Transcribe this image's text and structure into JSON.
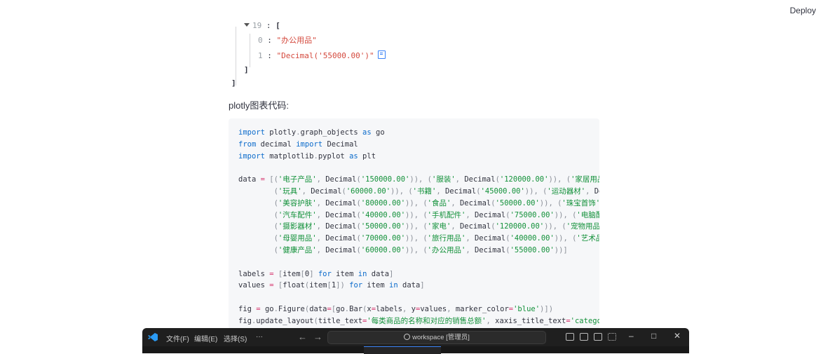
{
  "header": {
    "deploy_label": "Deploy"
  },
  "json_view": {
    "open_key": "19",
    "open_bracket": "[",
    "items": [
      {
        "key": "0",
        "value": "\"办公用品\""
      },
      {
        "key": "1",
        "value": "\"Decimal('55000.00')\""
      }
    ],
    "close_inner": "]",
    "close_outer": "]"
  },
  "section_label": "plotly图表代码:",
  "code_lines": [
    [
      [
        "kw",
        "import"
      ],
      [
        "t",
        " plotly"
      ],
      [
        "pn",
        "."
      ],
      [
        "t",
        "graph_objects "
      ],
      [
        "kw",
        "as"
      ],
      [
        "t",
        " go"
      ]
    ],
    [
      [
        "kw",
        "from"
      ],
      [
        "t",
        " decimal "
      ],
      [
        "kw",
        "import"
      ],
      [
        "t",
        " Decimal"
      ]
    ],
    [
      [
        "kw",
        "import"
      ],
      [
        "t",
        " matplotlib"
      ],
      [
        "pn",
        "."
      ],
      [
        "t",
        "pyplot "
      ],
      [
        "kw",
        "as"
      ],
      [
        "t",
        " plt"
      ]
    ],
    [
      [
        "t",
        ""
      ]
    ],
    [
      [
        "t",
        "data "
      ],
      [
        "op",
        "="
      ],
      [
        "t",
        " "
      ],
      [
        "pn",
        "[("
      ],
      [
        "st",
        "'电子产品'"
      ],
      [
        "pn",
        ", "
      ],
      [
        "t",
        "Decimal"
      ],
      [
        "pn",
        "("
      ],
      [
        "st",
        "'150000.00'"
      ],
      [
        "pn",
        "))"
      ],
      [
        "pn",
        ", ("
      ],
      [
        "st",
        "'服装'"
      ],
      [
        "pn",
        ", "
      ],
      [
        "t",
        "Decimal"
      ],
      [
        "pn",
        "("
      ],
      [
        "st",
        "'120000.00'"
      ],
      [
        "pn",
        "))"
      ],
      [
        "pn",
        ", ("
      ],
      [
        "st",
        "'家居用品'"
      ]
    ],
    [
      [
        "t",
        "        "
      ],
      [
        "pn",
        "("
      ],
      [
        "st",
        "'玩具'"
      ],
      [
        "pn",
        ", "
      ],
      [
        "t",
        "Decimal"
      ],
      [
        "pn",
        "("
      ],
      [
        "st",
        "'60000.00'"
      ],
      [
        "pn",
        "))"
      ],
      [
        "pn",
        ", ("
      ],
      [
        "st",
        "'书籍'"
      ],
      [
        "pn",
        ", "
      ],
      [
        "t",
        "Decimal"
      ],
      [
        "pn",
        "("
      ],
      [
        "st",
        "'45000.00'"
      ],
      [
        "pn",
        "))"
      ],
      [
        "pn",
        ", ("
      ],
      [
        "st",
        "'运动器材'"
      ],
      [
        "pn",
        ", "
      ],
      [
        "t",
        "De"
      ]
    ],
    [
      [
        "t",
        "        "
      ],
      [
        "pn",
        "("
      ],
      [
        "st",
        "'美容护肤'"
      ],
      [
        "pn",
        ", "
      ],
      [
        "t",
        "Decimal"
      ],
      [
        "pn",
        "("
      ],
      [
        "st",
        "'80000.00'"
      ],
      [
        "pn",
        "))"
      ],
      [
        "pn",
        ", ("
      ],
      [
        "st",
        "'食品'"
      ],
      [
        "pn",
        ", "
      ],
      [
        "t",
        "Decimal"
      ],
      [
        "pn",
        "("
      ],
      [
        "st",
        "'50000.00'"
      ],
      [
        "pn",
        "))"
      ],
      [
        "pn",
        ", ("
      ],
      [
        "st",
        "'珠宝首饰'"
      ]
    ],
    [
      [
        "t",
        "        "
      ],
      [
        "pn",
        "("
      ],
      [
        "st",
        "'汽车配件'"
      ],
      [
        "pn",
        ", "
      ],
      [
        "t",
        "Decimal"
      ],
      [
        "pn",
        "("
      ],
      [
        "st",
        "'40000.00'"
      ],
      [
        "pn",
        "))"
      ],
      [
        "pn",
        ", ("
      ],
      [
        "st",
        "'手机配件'"
      ],
      [
        "pn",
        ", "
      ],
      [
        "t",
        "Decimal"
      ],
      [
        "pn",
        "("
      ],
      [
        "st",
        "'75000.00'"
      ],
      [
        "pn",
        "))"
      ],
      [
        "pn",
        ", ("
      ],
      [
        "st",
        "'电脑配"
      ]
    ],
    [
      [
        "t",
        "        "
      ],
      [
        "pn",
        "("
      ],
      [
        "st",
        "'摄影器材'"
      ],
      [
        "pn",
        ", "
      ],
      [
        "t",
        "Decimal"
      ],
      [
        "pn",
        "("
      ],
      [
        "st",
        "'50000.00'"
      ],
      [
        "pn",
        "))"
      ],
      [
        "pn",
        ", ("
      ],
      [
        "st",
        "'家电'"
      ],
      [
        "pn",
        ", "
      ],
      [
        "t",
        "Decimal"
      ],
      [
        "pn",
        "("
      ],
      [
        "st",
        "'120000.00'"
      ],
      [
        "pn",
        "))"
      ],
      [
        "pn",
        ", ("
      ],
      [
        "st",
        "'宠物用品"
      ]
    ],
    [
      [
        "t",
        "        "
      ],
      [
        "pn",
        "("
      ],
      [
        "st",
        "'母婴用品'"
      ],
      [
        "pn",
        ", "
      ],
      [
        "t",
        "Decimal"
      ],
      [
        "pn",
        "("
      ],
      [
        "st",
        "'70000.00'"
      ],
      [
        "pn",
        "))"
      ],
      [
        "pn",
        ", ("
      ],
      [
        "st",
        "'旅行用品'"
      ],
      [
        "pn",
        ", "
      ],
      [
        "t",
        "Decimal"
      ],
      [
        "pn",
        "("
      ],
      [
        "st",
        "'40000.00'"
      ],
      [
        "pn",
        "))"
      ],
      [
        "pn",
        ", ("
      ],
      [
        "st",
        "'艺术品"
      ]
    ],
    [
      [
        "t",
        "        "
      ],
      [
        "pn",
        "("
      ],
      [
        "st",
        "'健康产品'"
      ],
      [
        "pn",
        ", "
      ],
      [
        "t",
        "Decimal"
      ],
      [
        "pn",
        "("
      ],
      [
        "st",
        "'60000.00'"
      ],
      [
        "pn",
        "))"
      ],
      [
        "pn",
        ", ("
      ],
      [
        "st",
        "'办公用品'"
      ],
      [
        "pn",
        ", "
      ],
      [
        "t",
        "Decimal"
      ],
      [
        "pn",
        "("
      ],
      [
        "st",
        "'55000.00'"
      ],
      [
        "pn",
        "))]"
      ]
    ],
    [
      [
        "t",
        ""
      ]
    ],
    [
      [
        "t",
        "labels "
      ],
      [
        "op",
        "="
      ],
      [
        "t",
        " "
      ],
      [
        "pn",
        "["
      ],
      [
        "t",
        "item"
      ],
      [
        "pn",
        "["
      ],
      [
        "t",
        "0"
      ],
      [
        "pn",
        "]"
      ],
      [
        "t",
        " "
      ],
      [
        "kw",
        "for"
      ],
      [
        "t",
        " item "
      ],
      [
        "kw",
        "in"
      ],
      [
        "t",
        " data"
      ],
      [
        "pn",
        "]"
      ]
    ],
    [
      [
        "t",
        "values "
      ],
      [
        "op",
        "="
      ],
      [
        "t",
        " "
      ],
      [
        "pn",
        "["
      ],
      [
        "t",
        "float"
      ],
      [
        "pn",
        "("
      ],
      [
        "t",
        "item"
      ],
      [
        "pn",
        "["
      ],
      [
        "t",
        "1"
      ],
      [
        "pn",
        "])"
      ],
      [
        "t",
        " "
      ],
      [
        "kw",
        "for"
      ],
      [
        "t",
        " item "
      ],
      [
        "kw",
        "in"
      ],
      [
        "t",
        " data"
      ],
      [
        "pn",
        "]"
      ]
    ],
    [
      [
        "t",
        ""
      ]
    ],
    [
      [
        "t",
        "fig "
      ],
      [
        "op",
        "="
      ],
      [
        "t",
        " go"
      ],
      [
        "pn",
        "."
      ],
      [
        "t",
        "Figure"
      ],
      [
        "pn",
        "("
      ],
      [
        "t",
        "data"
      ],
      [
        "op",
        "="
      ],
      [
        "pn",
        "["
      ],
      [
        "t",
        "go"
      ],
      [
        "pn",
        "."
      ],
      [
        "t",
        "Bar"
      ],
      [
        "pn",
        "("
      ],
      [
        "t",
        "x"
      ],
      [
        "op",
        "="
      ],
      [
        "t",
        "labels"
      ],
      [
        "pn",
        ", "
      ],
      [
        "t",
        "y"
      ],
      [
        "op",
        "="
      ],
      [
        "t",
        "values"
      ],
      [
        "pn",
        ", "
      ],
      [
        "t",
        "marker_color"
      ],
      [
        "op",
        "="
      ],
      [
        "st",
        "'blue'"
      ],
      [
        "pn",
        ")])"
      ]
    ],
    [
      [
        "t",
        "fig"
      ],
      [
        "pn",
        "."
      ],
      [
        "t",
        "update_layout"
      ],
      [
        "pn",
        "("
      ],
      [
        "t",
        "title_text"
      ],
      [
        "op",
        "="
      ],
      [
        "st",
        "'每类商品的名称和对应的销售总额'"
      ],
      [
        "pn",
        ", "
      ],
      [
        "t",
        "xaxis_title_text"
      ],
      [
        "op",
        "="
      ],
      [
        "st",
        "'catego"
      ]
    ]
  ],
  "taskbar": {
    "menu_file": "文件(F)",
    "menu_edit": "编辑(E)",
    "menu_select": "选择(S)",
    "menu_more": "···",
    "back": "←",
    "forward": "→",
    "search_text": "workspace [管理员]",
    "minimize": "–",
    "maximize": "□",
    "close": "✕"
  }
}
